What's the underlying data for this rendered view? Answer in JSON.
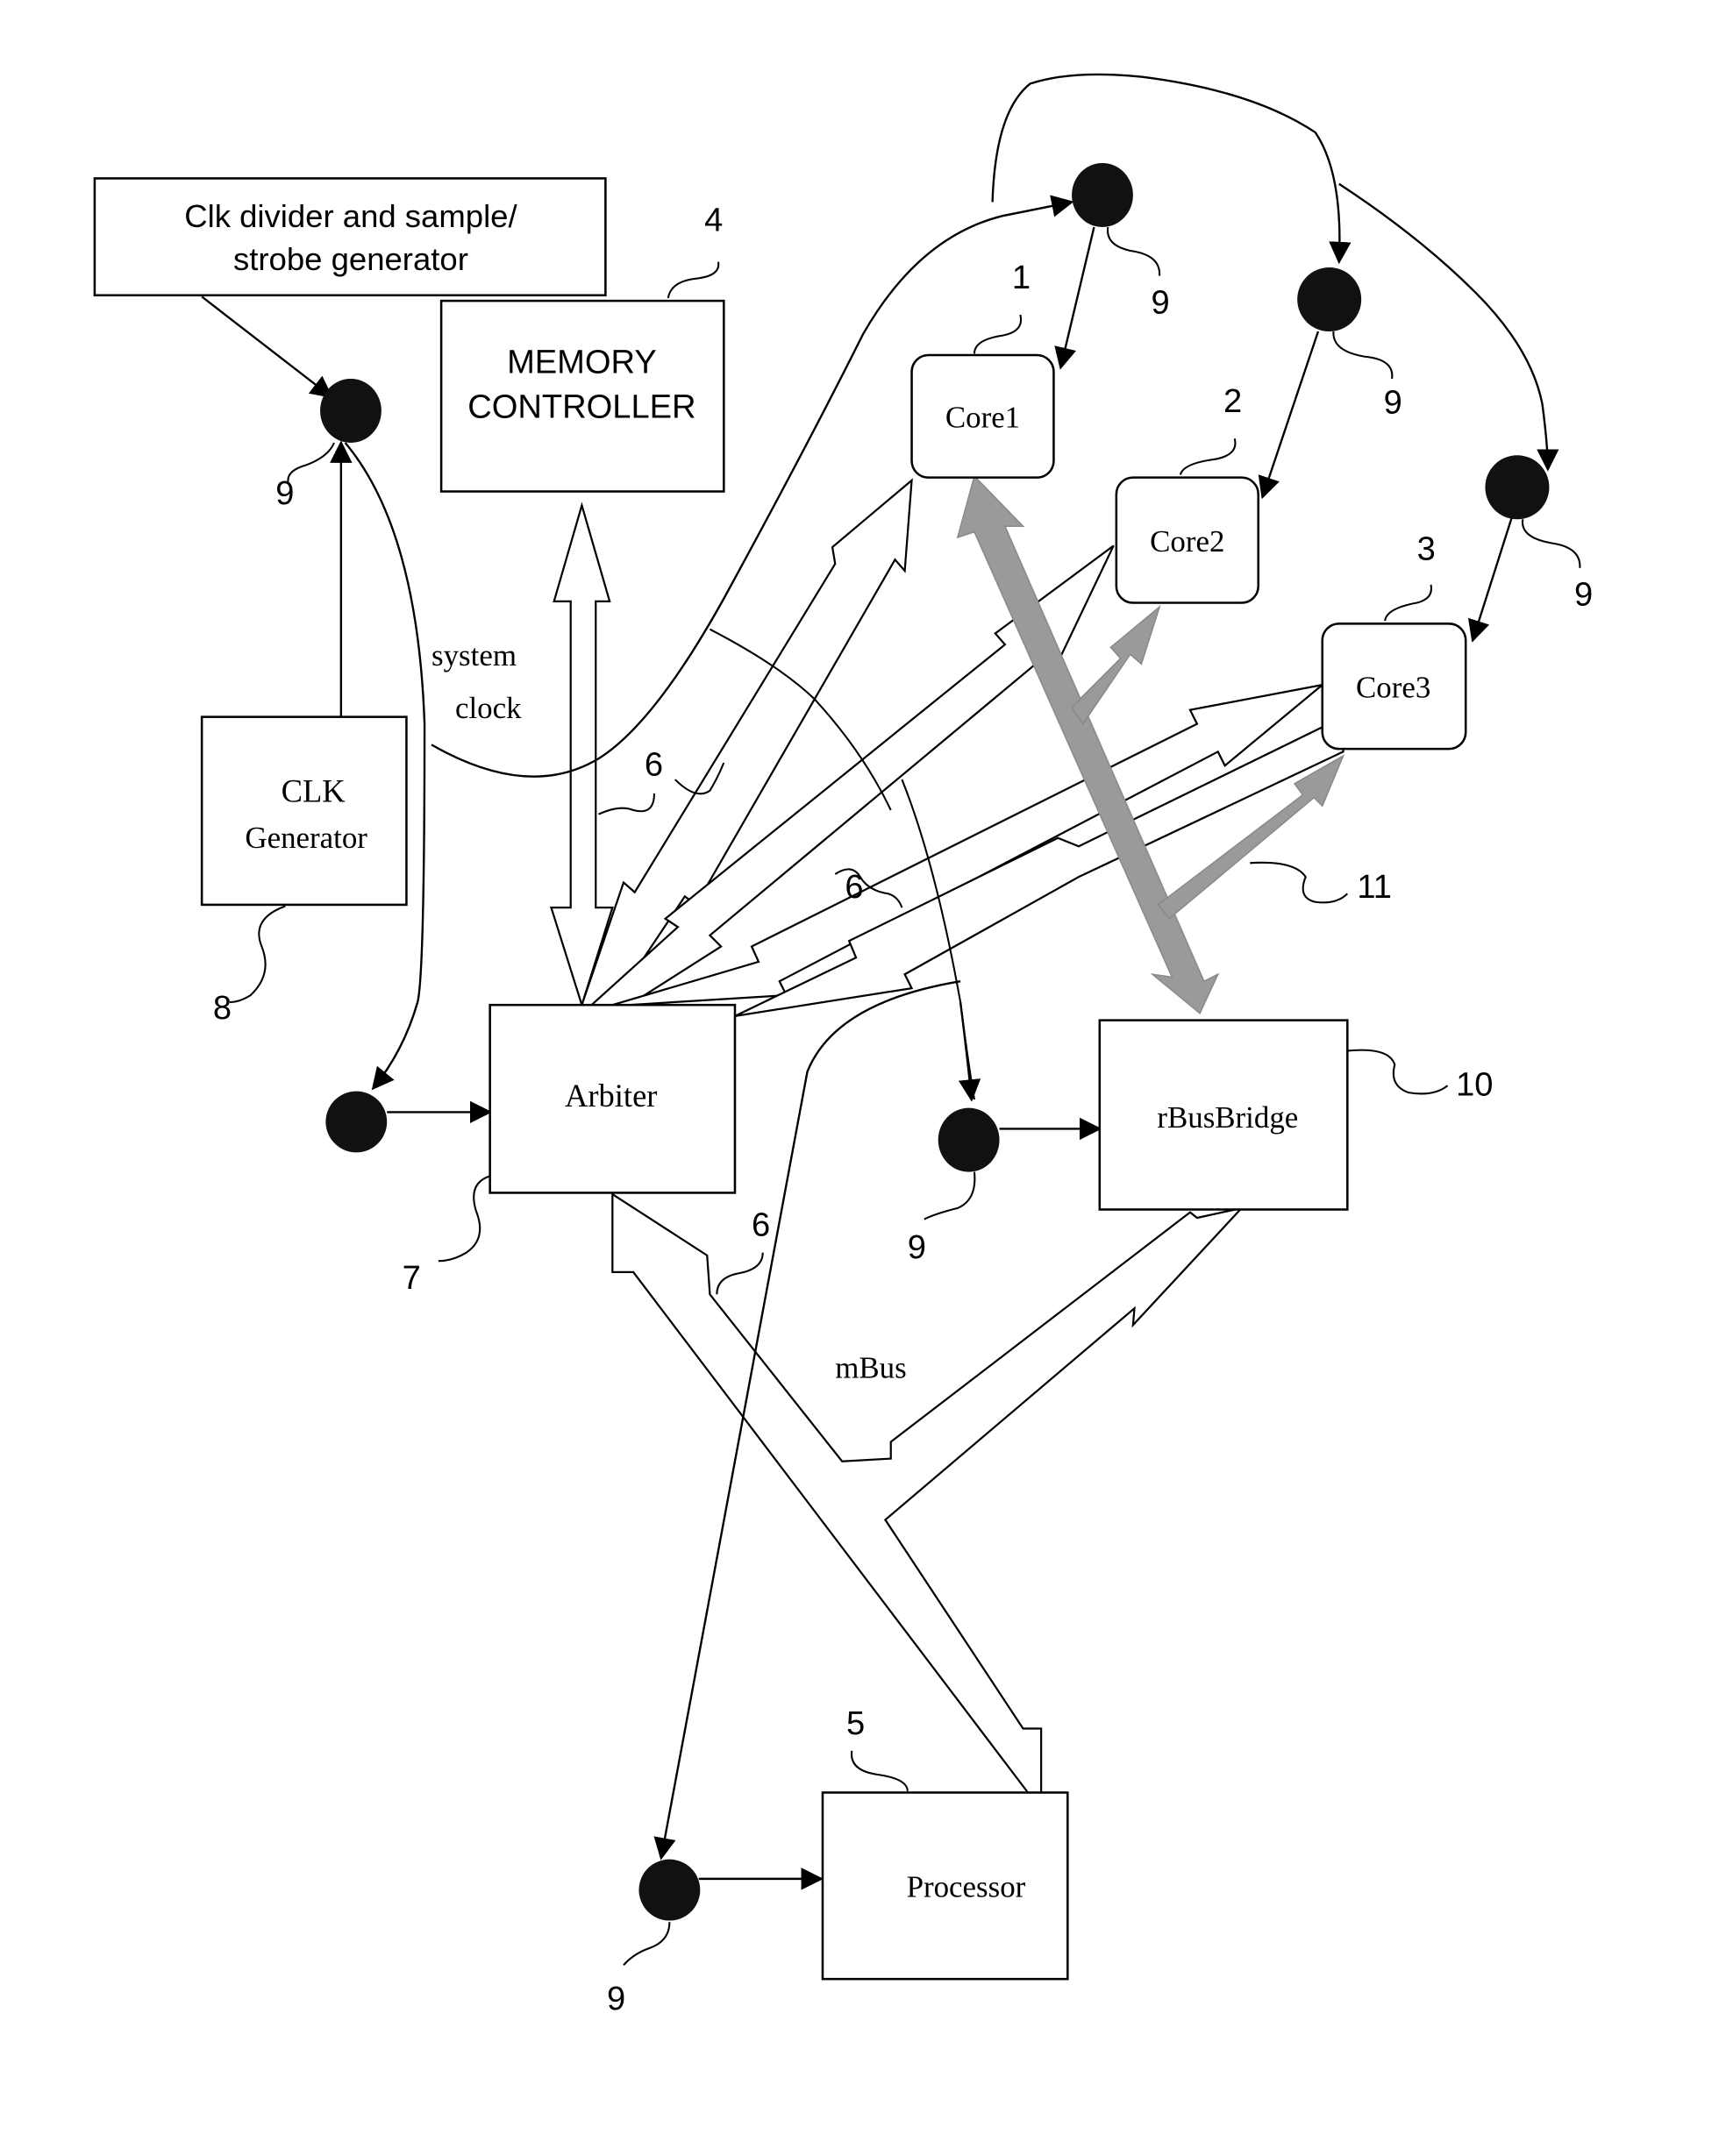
{
  "blocks": {
    "clk_divider": {
      "line1": "Clk divider and sample/",
      "line2": "strobe generator"
    },
    "memory_controller": {
      "line1": "MEMORY",
      "line2": "CONTROLLER",
      "ref": "4"
    },
    "core1": {
      "label": "Core1",
      "ref": "1"
    },
    "core2": {
      "label": "Core2",
      "ref": "2"
    },
    "core3": {
      "label": "Core3",
      "ref": "3"
    },
    "clk_generator": {
      "line1": "CLK",
      "line2": "Generator",
      "ref": "8"
    },
    "arbiter": {
      "label": "Arbiter",
      "ref": "7"
    },
    "rbusbridge": {
      "label": "rBusBridge",
      "ref": "10"
    },
    "processor": {
      "label": "Processor",
      "ref": "5"
    }
  },
  "labels": {
    "system_clock_1": "system",
    "system_clock_2": "clock",
    "mbus": "mBus",
    "bus_ref": "6",
    "rbus_ref": "11",
    "sync_ref": "9"
  }
}
